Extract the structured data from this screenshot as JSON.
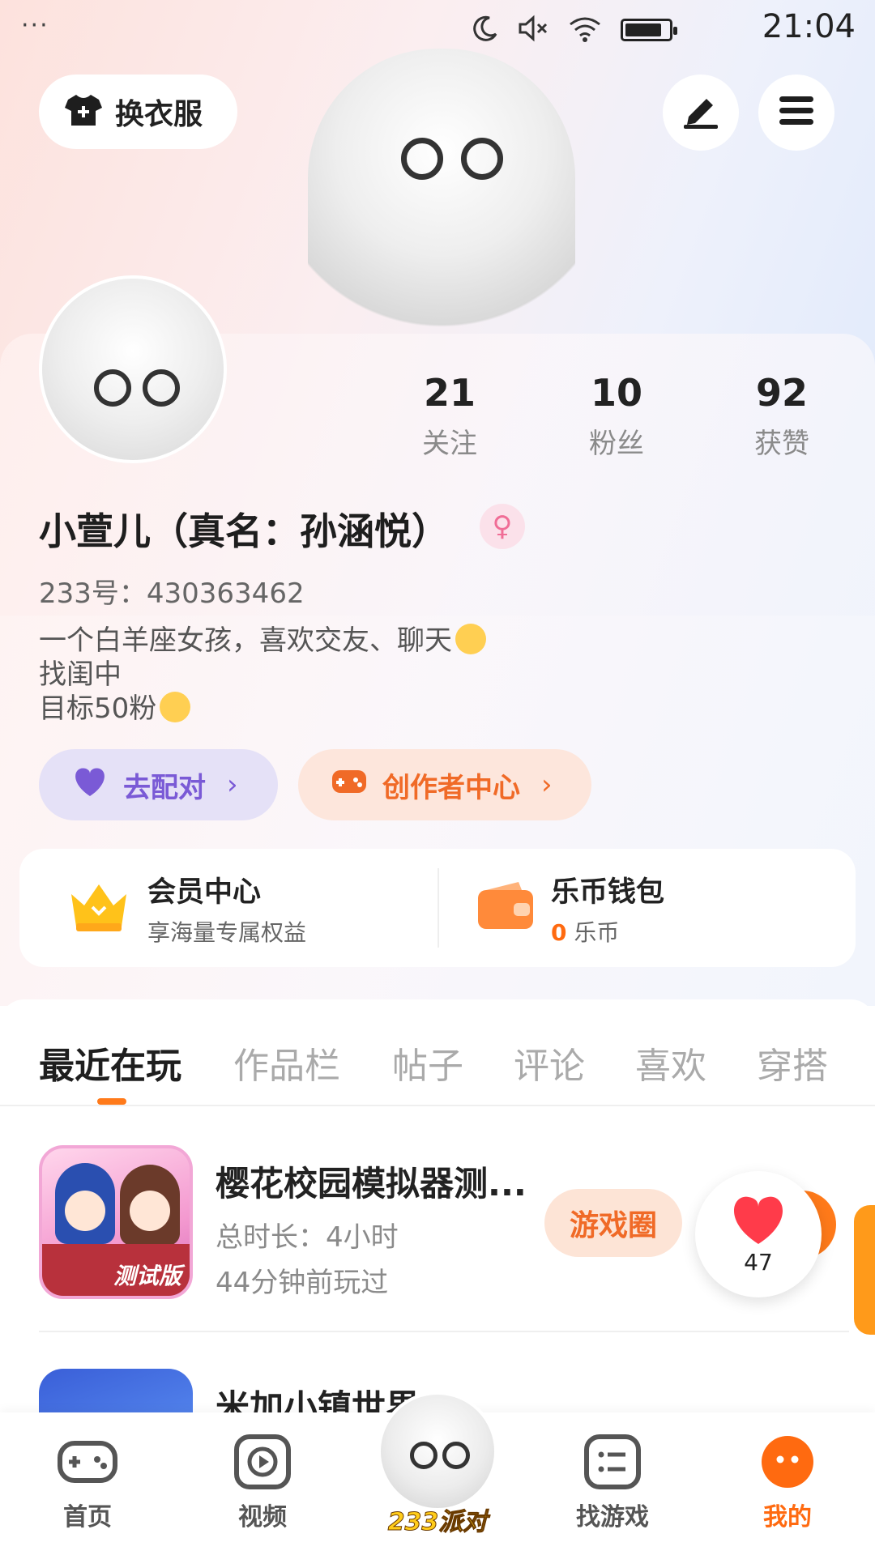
{
  "status_bar": {
    "dots": "···",
    "time": "21:04",
    "battery_level": 0.85
  },
  "top_bar": {
    "dress_label": "换衣服",
    "edit_icon": "pen-icon",
    "menu_icon": "menu-icon"
  },
  "profile": {
    "stats": [
      {
        "num": "21",
        "label": "关注"
      },
      {
        "num": "10",
        "label": "粉丝"
      },
      {
        "num": "92",
        "label": "获赞"
      }
    ],
    "name": "小萱儿（真名：孙涵悦）",
    "gender_symbol": "♀",
    "uid": "233号：430363462",
    "bio_lines": [
      "一个白羊座女孩，喜欢交友、聊天",
      "找闺中",
      "目标50粉"
    ],
    "match_button": "去配对",
    "creator_button": "创作者中心",
    "chevron": "›"
  },
  "info_card": {
    "vip_title": "会员中心",
    "vip_sub": "享海量专属权益",
    "wallet_title": "乐币钱包",
    "wallet_amount": "0",
    "wallet_unit": "乐币"
  },
  "tabs": [
    "最近在玩",
    "作品栏",
    "帖子",
    "评论",
    "喜欢",
    "穿搭"
  ],
  "games": [
    {
      "title": "樱花校园模拟器测...",
      "duration": "总时长：4小时",
      "last_played": "44分钟前玩过",
      "circle_label": "游戏圈",
      "icon_badge": "测试版"
    },
    {
      "title": "米加小镇世界"
    }
  ],
  "like": {
    "count": "47"
  },
  "bottom_nav": [
    {
      "label": "首页"
    },
    {
      "label": "视频"
    },
    {
      "label": "233派对"
    },
    {
      "label": "找游戏"
    },
    {
      "label": "我的"
    }
  ],
  "colors": {
    "accent": "#ff6a10",
    "match": "#7a5ad6",
    "creator": "#f06a27"
  }
}
